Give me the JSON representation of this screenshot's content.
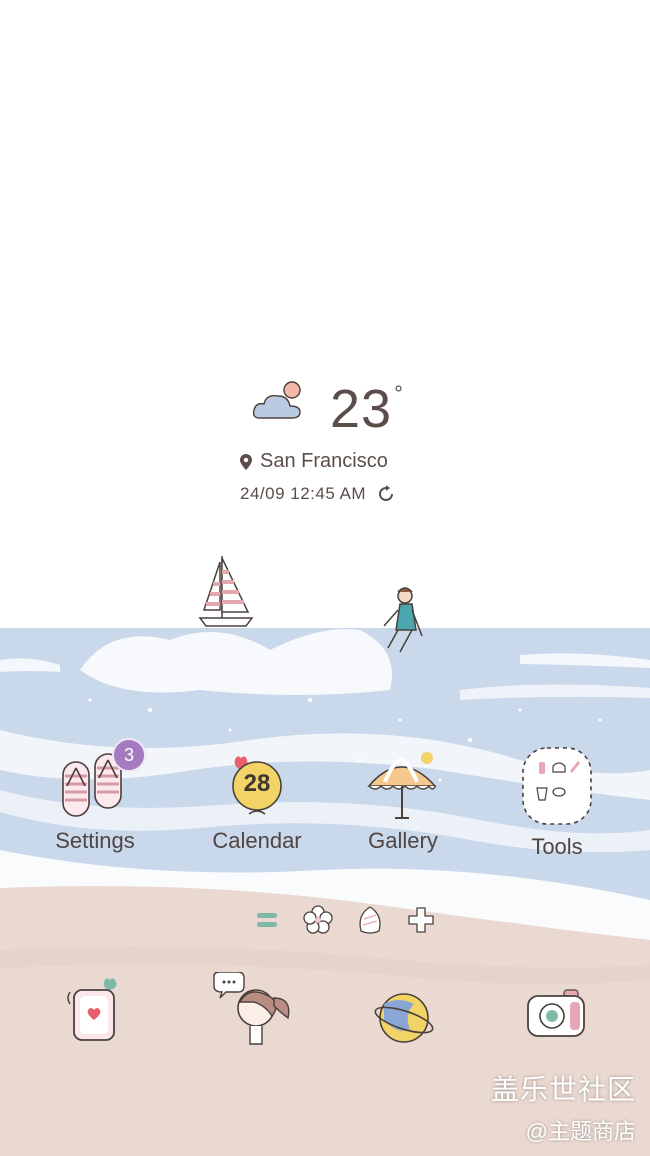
{
  "weather": {
    "temperature": "23",
    "degree_symbol": "°",
    "location": "San Francisco",
    "datetime": "24/09 12:45 AM",
    "condition_icon": "partly-cloudy-icon",
    "refresh_icon": "refresh-icon"
  },
  "apps": [
    {
      "label": "Settings",
      "icon": "flip-flops-icon",
      "badge": "3"
    },
    {
      "label": "Calendar",
      "icon": "balloon-calendar-icon",
      "date": "28"
    },
    {
      "label": "Gallery",
      "icon": "beach-umbrella-icon"
    },
    {
      "label": "Tools",
      "icon": "tools-folder-icon"
    }
  ],
  "dock": [
    {
      "icon": "phone-heart-icon"
    },
    {
      "icon": "girl-chat-icon"
    },
    {
      "icon": "planet-browser-icon"
    },
    {
      "icon": "camera-icon"
    }
  ],
  "watermark": {
    "line1": "盖乐世社区",
    "line2": "@主题商店"
  },
  "colors": {
    "sea": "#c9d8ea",
    "sand": "#ead9d0",
    "badge": "#a57ac0",
    "text": "#5b4e4a"
  }
}
